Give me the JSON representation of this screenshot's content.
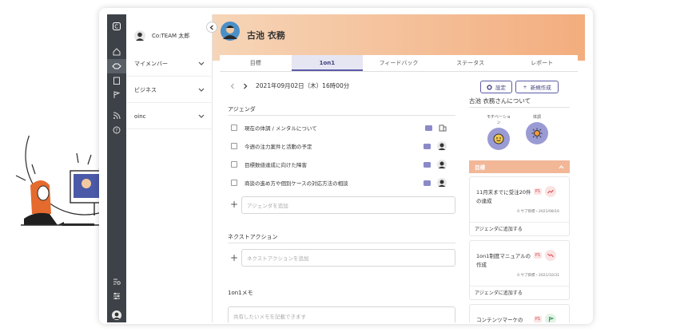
{
  "sidebar": {
    "user_name": "Co:TEAM 太郎",
    "groups": [
      {
        "label": "マイメンバー"
      },
      {
        "label": "ビジネス"
      },
      {
        "label": "oinc"
      }
    ]
  },
  "profile": {
    "name": "古池 衣務"
  },
  "tabs": [
    {
      "label": "目標"
    },
    {
      "label": "1on1"
    },
    {
      "label": "フィードバック"
    },
    {
      "label": "ステータス"
    },
    {
      "label": "レポート"
    }
  ],
  "session": {
    "date": "2021年09月02日（木）16時00分",
    "settings_label": "設定",
    "new_label": "新規作成"
  },
  "agenda": {
    "title": "アジェンダ",
    "items": [
      {
        "label": "現在の体調 / メンタルについて"
      },
      {
        "label": "今週の注力案件と活動の予定"
      },
      {
        "label": "目標数値達成に向けた障害"
      },
      {
        "label": "商談の進め方や個別ケースの対応方法の相談"
      }
    ],
    "add_placeholder": "アジェンダを追加"
  },
  "next_action": {
    "title": "ネクストアクション",
    "add_placeholder": "ネクストアクションを追加"
  },
  "memo": {
    "title": "1on1メモ",
    "placeholder": "共有したいメモを記載できます"
  },
  "about": {
    "title": "古池 衣務さんについて",
    "motivation_label": "モチベーション",
    "health_label": "体調",
    "goals_header": "目標",
    "goals": [
      {
        "title": "11月末までに受注20件の達成",
        "priority": "P1",
        "meta": "0 サブ目標・2021/08/16",
        "footer": "アジェンダに追加する"
      },
      {
        "title": "1on1制度マニュアルの作成",
        "priority": "P1",
        "meta": "0 サブ目標・2021/10/31",
        "footer": "アジェンダに追加する"
      },
      {
        "title": "コンテンツマーケの",
        "priority": "P1"
      }
    ]
  },
  "colors": {
    "accent": "#5a5aa6",
    "header_from": "#f6d5b8",
    "header_to": "#f3ad7e",
    "rail": "#3d4248"
  }
}
